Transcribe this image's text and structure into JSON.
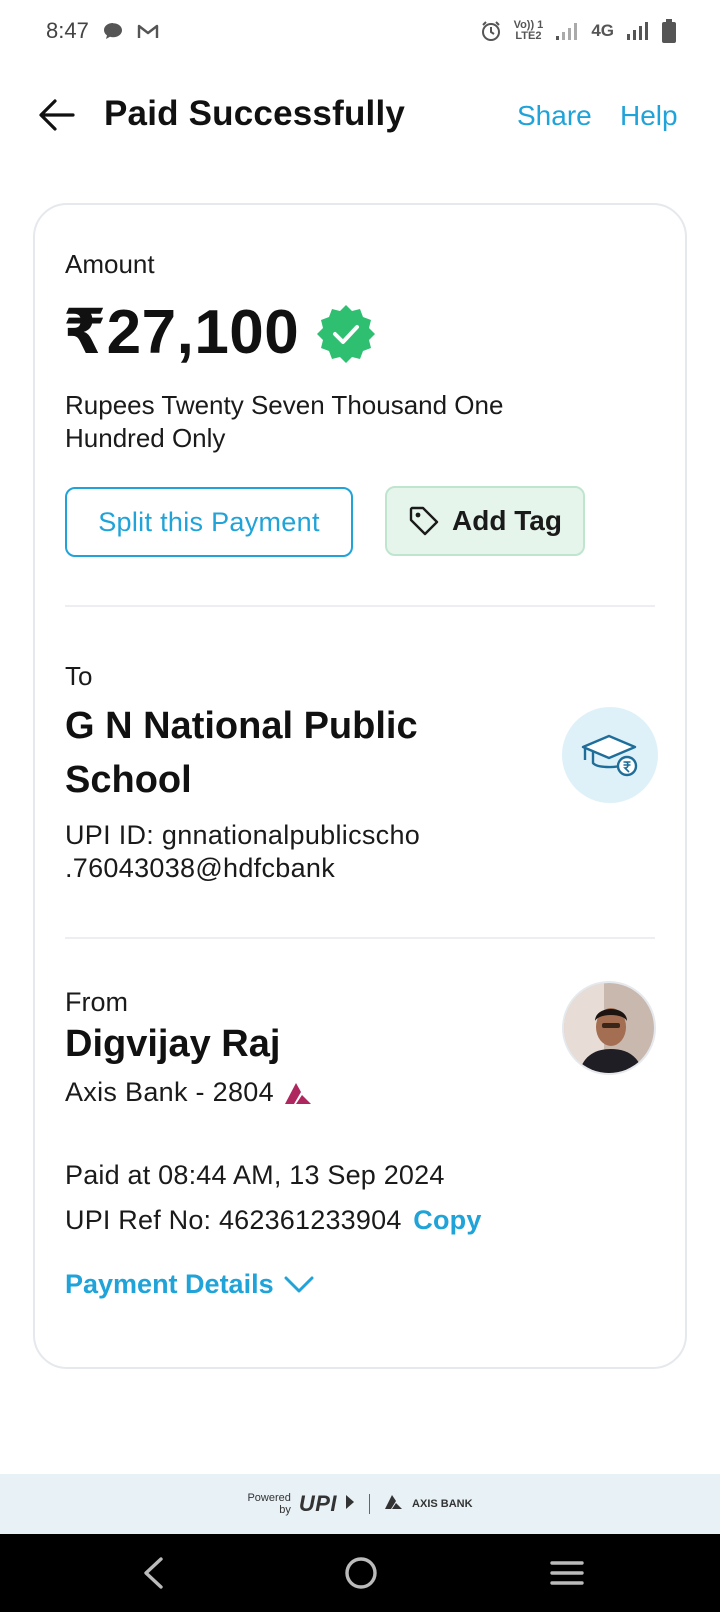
{
  "status_bar": {
    "time": "8:47",
    "network": "4G",
    "lte_label": "LTE2",
    "volte_label": "Vo)) 1"
  },
  "header": {
    "title": "Paid Successfully",
    "share_label": "Share",
    "help_label": "Help"
  },
  "amount": {
    "label": "Amount",
    "value": "₹27,100",
    "words": "Rupees Twenty Seven Thousand One Hundred Only"
  },
  "actions": {
    "split_label": "Split this Payment",
    "tag_label": "Add Tag"
  },
  "recipient": {
    "label": "To",
    "name": "G N National Public School",
    "upi_id": "UPI ID: gnnationalpublicscho .76043038@hdfcbank"
  },
  "sender": {
    "label": "From",
    "name": "Digvijay Raj",
    "bank": "Axis Bank - 2804"
  },
  "transaction": {
    "paid_at": "Paid at 08:44 AM, 13 Sep 2024",
    "ref_prefix": "UPI Ref No: 462361233904",
    "copy_label": "Copy",
    "details_label": "Payment Details"
  },
  "footer": {
    "powered": "Powered",
    "by": "by",
    "upi": "UPI",
    "bank": "AXIS BANK"
  },
  "colors": {
    "accent": "#20a3d8",
    "success": "#2fbf71",
    "tag_bg": "#e6f5ec",
    "axis_brand": "#ae275f"
  },
  "icons": {
    "back": "arrow-left-icon",
    "verified": "verified-badge-icon",
    "tag": "tag-icon",
    "school": "graduation-cap-rupee-icon",
    "chevron": "chevron-down-icon"
  }
}
